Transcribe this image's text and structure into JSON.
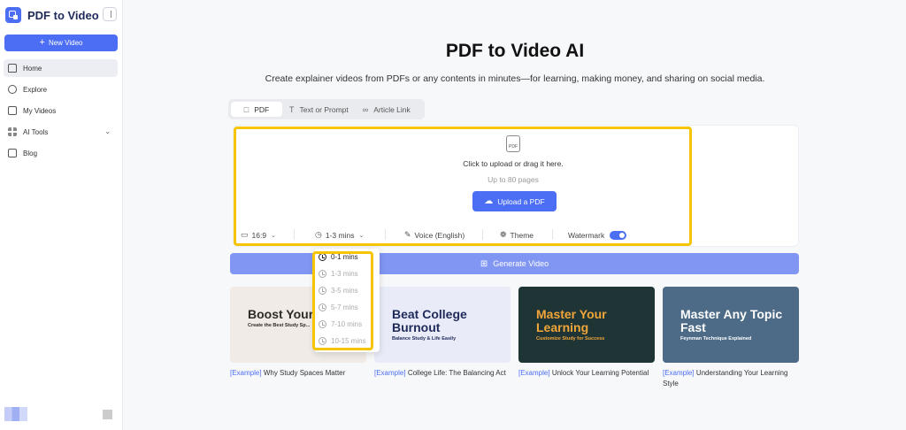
{
  "app": {
    "name": "PDF to Video"
  },
  "sidebar": {
    "new_video_label": "New Video",
    "items": [
      {
        "label": "Home",
        "icon": "home-icon",
        "active": true
      },
      {
        "label": "Explore",
        "icon": "compass-icon"
      },
      {
        "label": "My Videos",
        "icon": "video-icon"
      },
      {
        "label": "AI Tools",
        "icon": "grid-icon",
        "expandable": true
      },
      {
        "label": "Blog",
        "icon": "document-icon"
      }
    ]
  },
  "hero": {
    "title": "PDF to Video AI",
    "subtitle": "Create explainer videos from PDFs or any contents in minutes—for learning, making money, and sharing on social media."
  },
  "tabs": [
    {
      "label": "PDF",
      "active": true
    },
    {
      "label": "Text or Prompt"
    },
    {
      "label": "Article Link"
    }
  ],
  "upload": {
    "hint": "Click to upload or drag it here.",
    "limit": "Up to 80 pages",
    "button_label": "Upload a PDF",
    "pdf_icon_text": "PDF"
  },
  "options": {
    "aspect_ratio": "16:9",
    "duration": "1-3 mins",
    "voice": "Voice (English)",
    "theme": "Theme",
    "watermark": "Watermark",
    "watermark_on": true
  },
  "duration_dropdown": {
    "options": [
      "0-1 mins",
      "1-3 mins",
      "3-5 mins",
      "5-7 mins",
      "7-10 mins",
      "10-15 mins"
    ],
    "selected": "0-1 mins"
  },
  "generate_label": "Generate Video",
  "examples": [
    {
      "tag": "[Example]",
      "caption": "Why Study Spaces Matter",
      "thumb_title": "Boost Your Focus",
      "thumb_sub": "Create the Best Study Sp...",
      "bg": "#f0ebe6",
      "title_color": "#2e2a26",
      "sub_color": "#2e2a26"
    },
    {
      "tag": "[Example]",
      "caption": "College Life: The Balancing Act",
      "thumb_title": "Beat College Burnout",
      "thumb_sub": "Balance Study & Life Easily",
      "bg": "#e9ecf8",
      "title_color": "#1f2a5a",
      "sub_color": "#1f2a5a"
    },
    {
      "tag": "[Example]",
      "caption": "Unlock Your Learning Potential",
      "thumb_title": "Master Your Learning",
      "thumb_sub": "Customize Study for Success",
      "bg": "#1f3434",
      "title_color": "#f2a63a",
      "sub_color": "#f2a63a"
    },
    {
      "tag": "[Example]",
      "caption": "Understanding Your Learning Style",
      "thumb_title": "Master Any Topic Fast",
      "thumb_sub": "Feynman Technique Explained",
      "bg": "#4d6a86",
      "title_color": "#ffffff",
      "sub_color": "#ffffff"
    }
  ],
  "colors": {
    "accent": "#4c6ef5",
    "highlight": "#f6c400"
  }
}
